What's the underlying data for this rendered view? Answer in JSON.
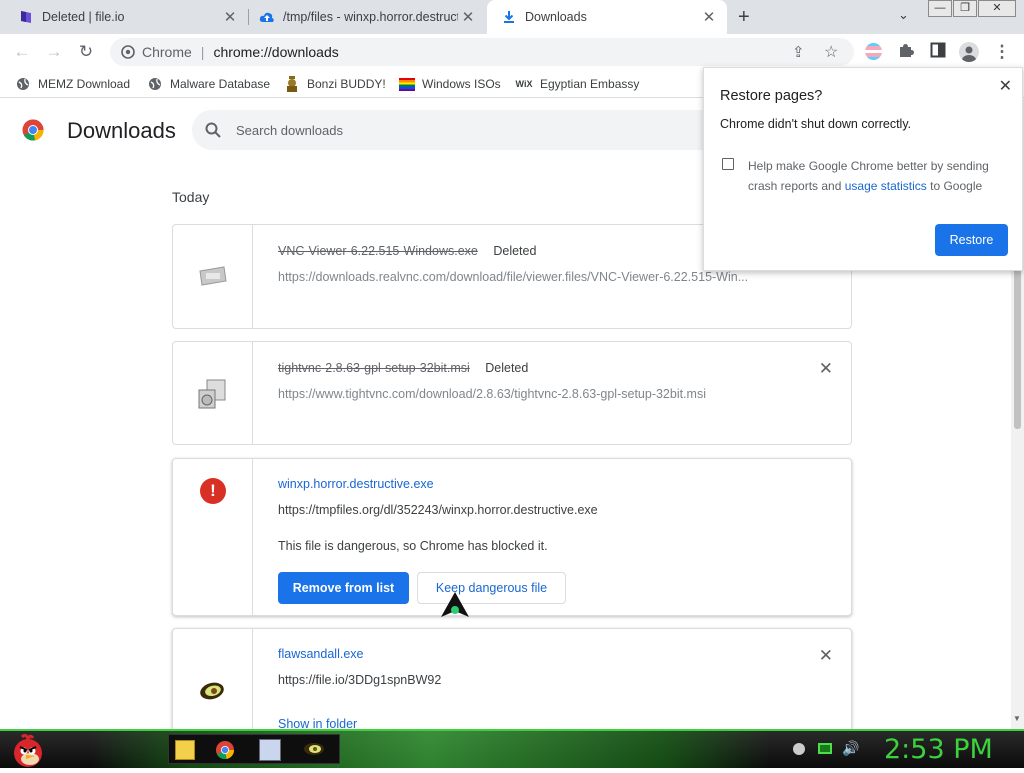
{
  "tabs": [
    {
      "title": "Deleted | file.io",
      "active": false
    },
    {
      "title": "/tmp/files - winxp.horror.destructi",
      "active": false
    },
    {
      "title": "Downloads",
      "active": true
    }
  ],
  "toolbar": {
    "scheme_label": "Chrome",
    "url": "chrome://downloads"
  },
  "bookmarks": [
    {
      "label": "MEMZ Download"
    },
    {
      "label": "Malware Database"
    },
    {
      "label": "Bonzi BUDDY!"
    },
    {
      "label": "Windows ISOs"
    },
    {
      "label": "Egyptian Embassy"
    }
  ],
  "page": {
    "title": "Downloads",
    "search_placeholder": "Search downloads",
    "section": "Today"
  },
  "downloads": [
    {
      "file": "VNC-Viewer-6.22.515-Windows.exe",
      "status": "Deleted",
      "url": "https://downloads.realvnc.com/download/file/viewer.files/VNC-Viewer-6.22.515-Win..."
    },
    {
      "file": "tightvnc-2.8.63-gpl-setup-32bit.msi",
      "status": "Deleted",
      "url": "https://www.tightvnc.com/download/2.8.63/tightvnc-2.8.63-gpl-setup-32bit.msi"
    },
    {
      "file": "winxp.horror.destructive.exe",
      "url": "https://tmpfiles.org/dl/352243/winxp.horror.destructive.exe",
      "warning": "This file is dangerous, so Chrome has blocked it.",
      "remove_label": "Remove from list",
      "keep_label": "Keep dangerous file"
    },
    {
      "file": "flawsandall.exe",
      "url": "https://file.io/3DDg1spnBW92",
      "show_folder": "Show in folder"
    }
  ],
  "restore_popup": {
    "title": "Restore pages?",
    "message": "Chrome didn't shut down correctly.",
    "checkbox_text_1": "Help make Google Chrome better by sending",
    "checkbox_text_2": "crash reports and",
    "link": "usage statistics",
    "checkbox_text_3": "to Google",
    "button": "Restore"
  },
  "taskbar": {
    "clock": "2:53 PM"
  },
  "colors": {
    "accent": "#1a73e8",
    "danger": "#d93025",
    "link": "#1967d2",
    "taskbar_green": "#3bd23b"
  }
}
